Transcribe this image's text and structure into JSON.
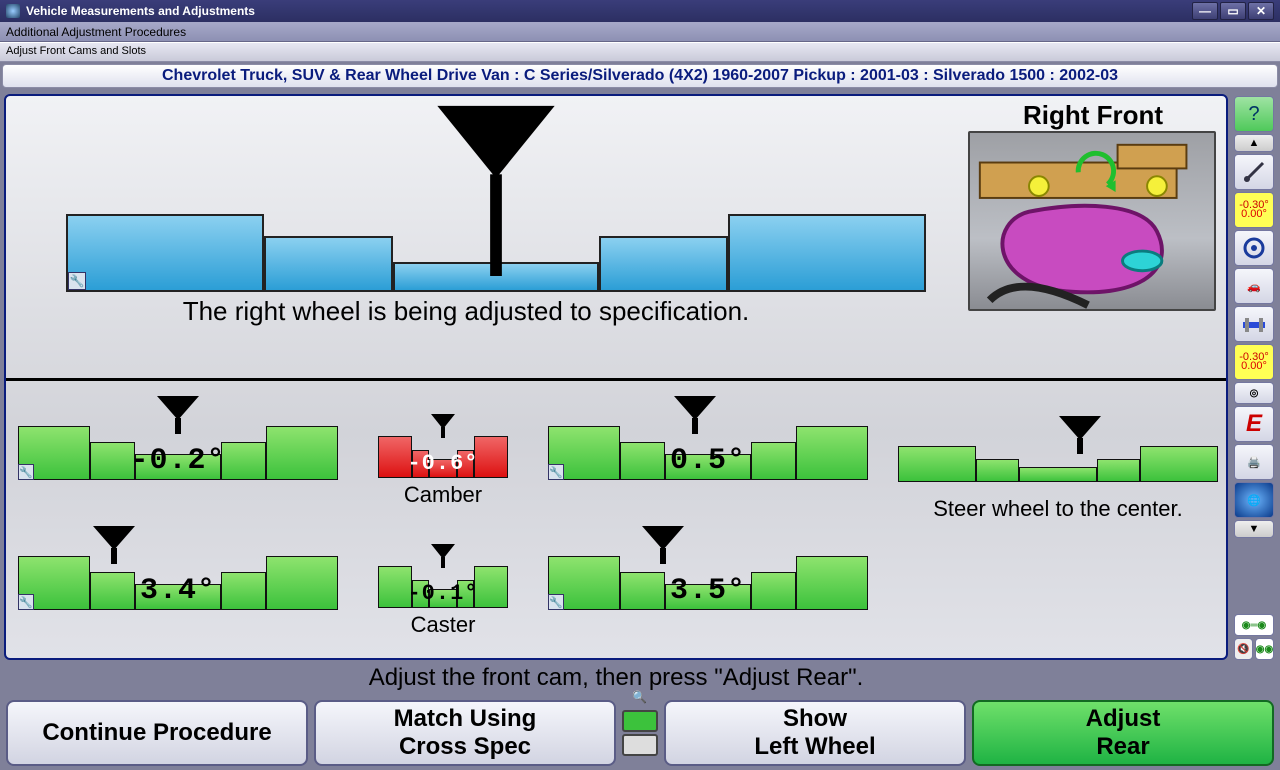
{
  "window": {
    "title": "Vehicle Measurements and Adjustments",
    "menu": "Additional Adjustment Procedures",
    "submenu": "Adjust Front Cams and Slots"
  },
  "vehicle": "Chevrolet Truck, SUV & Rear Wheel Drive Van : C Series/Silverado (4X2) 1960-2007 Pickup : 2001-03 : Silverado 1500 : 2002-03",
  "main_caption": "The right wheel is being adjusted to specification.",
  "illustration_title": "Right Front",
  "gauges": {
    "left_camber": "-0.2°",
    "cross_camber": "-0.6°",
    "right_camber": "0.5°",
    "camber_label": "Camber",
    "left_caster": "3.4°",
    "cross_caster": "-0.1°",
    "right_caster": "3.5°",
    "caster_label": "Caster",
    "steer_caption": "Steer wheel to the center."
  },
  "instruction": "Adjust the front cam, then press \"Adjust Rear\".",
  "buttons": {
    "b1": "Continue Procedure",
    "b2a": "Match Using",
    "b2b": "Cross Spec",
    "b3a": "Show",
    "b3b": "Left Wheel",
    "b4a": "Adjust",
    "b4b": "Rear"
  },
  "sidebar": {
    "val_a": "-0.30°",
    "val_b": "0.00°"
  }
}
